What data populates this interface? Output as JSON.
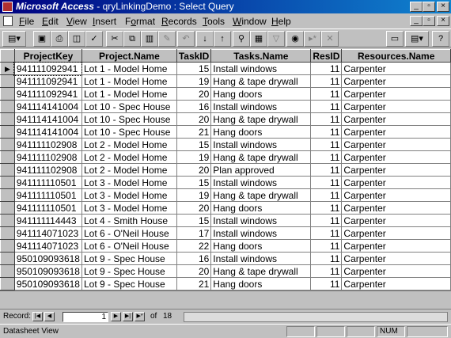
{
  "window": {
    "app_name": "Microsoft Access",
    "document_title": " - qryLinkingDemo : Select Query"
  },
  "title_buttons": {
    "minimize": "_",
    "maximize": "▫",
    "close": "×"
  },
  "menu": {
    "items": [
      {
        "accel": "F",
        "rest": "ile"
      },
      {
        "accel": "E",
        "rest": "dit"
      },
      {
        "accel": "V",
        "rest": "iew"
      },
      {
        "accel": "I",
        "rest": "nsert"
      },
      {
        "pre": "F",
        "accel": "o",
        "rest": "rmat"
      },
      {
        "accel": "R",
        "rest": "ecords"
      },
      {
        "accel": "T",
        "rest": "ools"
      },
      {
        "accel": "W",
        "rest": "indow"
      },
      {
        "accel": "H",
        "rest": "elp"
      }
    ]
  },
  "columns": [
    "ProjectKey",
    "Project.Name",
    "TaskID",
    "Tasks.Name",
    "ResID",
    "Resources.Name"
  ],
  "rows": [
    [
      "941111092941",
      "Lot 1 - Model Home",
      "15",
      "Install windows",
      "11",
      "Carpenter"
    ],
    [
      "941111092941",
      "Lot 1 - Model Home",
      "19",
      "Hang & tape drywall",
      "11",
      "Carpenter"
    ],
    [
      "941111092941",
      "Lot 1 - Model Home",
      "20",
      "Hang doors",
      "11",
      "Carpenter"
    ],
    [
      "941114141004",
      "Lot 10 - Spec House",
      "16",
      "Install windows",
      "11",
      "Carpenter"
    ],
    [
      "941114141004",
      "Lot 10 - Spec House",
      "20",
      "Hang & tape drywall",
      "11",
      "Carpenter"
    ],
    [
      "941114141004",
      "Lot 10 - Spec House",
      "21",
      "Hang doors",
      "11",
      "Carpenter"
    ],
    [
      "941111102908",
      "Lot 2 - Model Home",
      "15",
      "Install windows",
      "11",
      "Carpenter"
    ],
    [
      "941111102908",
      "Lot 2 - Model Home",
      "19",
      "Hang & tape drywall",
      "11",
      "Carpenter"
    ],
    [
      "941111102908",
      "Lot 2 - Model Home",
      "20",
      "Plan approved",
      "11",
      "Carpenter"
    ],
    [
      "941111110501",
      "Lot 3 - Model Home",
      "15",
      "Install windows",
      "11",
      "Carpenter"
    ],
    [
      "941111110501",
      "Lot 3 - Model Home",
      "19",
      "Hang & tape drywall",
      "11",
      "Carpenter"
    ],
    [
      "941111110501",
      "Lot 3 - Model Home",
      "20",
      "Hang doors",
      "11",
      "Carpenter"
    ],
    [
      "941111114443",
      "Lot 4 - Smith House",
      "15",
      "Install windows",
      "11",
      "Carpenter"
    ],
    [
      "941114071023",
      "Lot 6 - O'Neil House",
      "17",
      "Install windows",
      "11",
      "Carpenter"
    ],
    [
      "941114071023",
      "Lot 6 - O'Neil House",
      "22",
      "Hang doors",
      "11",
      "Carpenter"
    ],
    [
      "950109093618",
      "Lot 9 - Spec House",
      "16",
      "Install windows",
      "11",
      "Carpenter"
    ],
    [
      "950109093618",
      "Lot 9 - Spec House",
      "20",
      "Hang & tape drywall",
      "11",
      "Carpenter"
    ],
    [
      "950109093618",
      "Lot 9 - Spec House",
      "21",
      "Hang doors",
      "11",
      "Carpenter"
    ]
  ],
  "current_row_marker": "▶",
  "record_nav": {
    "label": "Record:",
    "current": "1",
    "of_label": "of",
    "total": "18"
  },
  "status": {
    "view": "Datasheet View",
    "num": "NUM"
  },
  "icons": [
    "view-icon",
    "save-icon",
    "print-icon",
    "print-preview-icon",
    "spelling-icon",
    "cut-icon",
    "copy-icon",
    "paste-icon",
    "format-painter-icon",
    "undo-icon",
    "sort-ascending-icon",
    "sort-descending-icon",
    "filter-by-selection-icon",
    "filter-by-form-icon",
    "apply-filter-icon",
    "find-icon",
    "new-record-icon",
    "delete-record-icon",
    "database-window-icon",
    "new-object-icon",
    "help-icon"
  ]
}
